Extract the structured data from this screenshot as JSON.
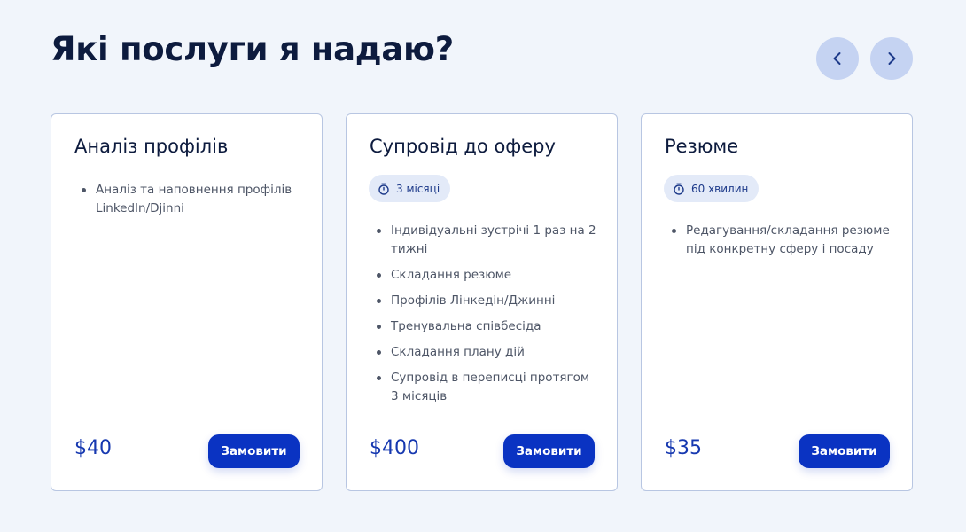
{
  "header": {
    "title": "Які послуги я надаю?"
  },
  "nav": {
    "prev_icon": "chevron-left-icon",
    "next_icon": "chevron-right-icon",
    "button_color": "#c5d3f2",
    "icon_color": "#1d3a8a"
  },
  "cards": [
    {
      "title": "Аналіз профілів",
      "badge": null,
      "features": [
        "Аналіз та наповнення профілів LinkedIn/Djinni"
      ],
      "price": "$40",
      "button": "Замовити"
    },
    {
      "title": "Супровід до оферу",
      "badge": "3 місяці",
      "features": [
        "Індивідуальні зустрічі 1 раз на 2 тижні",
        "Складання резюме",
        "Профілів Лінкедін/Джинні",
        "Тренувальна співбесіда",
        "Складання плану дій",
        "Супровід в переписці протягом 3 місяців"
      ],
      "price": "$400",
      "button": "Замовити"
    },
    {
      "title": "Резюме",
      "badge": "60 хвилин",
      "features": [
        "Редагування/складання резюме під конкретну сферу і посаду"
      ],
      "price": "$35",
      "button": "Замовити"
    }
  ],
  "colors": {
    "background": "#f1f5fb",
    "accent": "#0a33c2",
    "price": "#1638b0",
    "badge_bg": "#e3eaf8"
  }
}
